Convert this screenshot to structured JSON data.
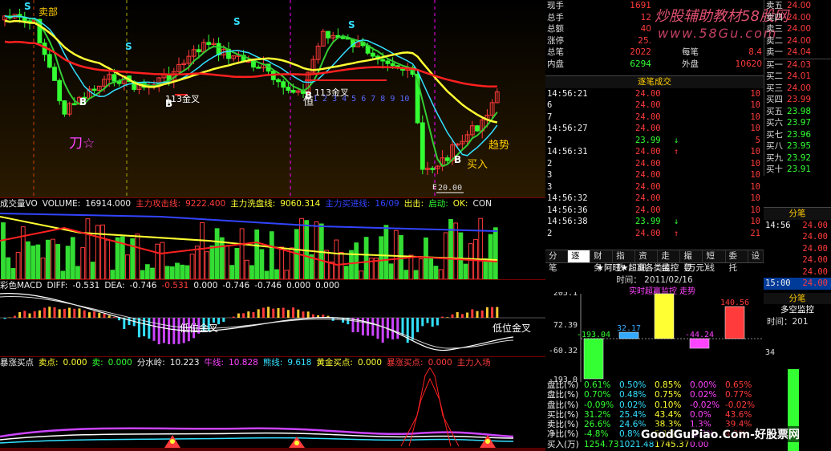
{
  "main": {
    "candle_labels": {
      "top_left": "卖部",
      "s_marks": [
        "S",
        "S",
        "S",
        "S"
      ],
      "b_marks": [
        "B",
        "B",
        "B",
        "B"
      ],
      "golden_cross_1": "113金叉",
      "golden_cross_2": "113金叉",
      "bottom_label": "刀☆",
      "trend": "趋势",
      "buy": "买入",
      "low_price": "20.00",
      "marker_e": "E",
      "marker_ha": "恒",
      "seq": "1 2 3 4 5 6 7 8 9 10"
    },
    "volume": {
      "title": "成交量VO",
      "volume_label": "VOLUME:",
      "volume_value": "16914.000",
      "main_attack": "主力攻击线:",
      "main_attack_val": "9222.400",
      "main_wash": "主力洗盘线:",
      "main_wash_val": "9060.314",
      "extra": "主力买进线:",
      "extra_val": "16/09",
      "shipping": "出击:",
      "start": "启动:",
      "ok": "OK:",
      "conf": "CON"
    },
    "macd": {
      "title": "彩色MACD",
      "diff_label": "DIFF:",
      "diff_val": "-0.531",
      "dea_label": "DEA:",
      "dea_val": "-0.746",
      "v3": "-0.531",
      "v4": "0.000",
      "v5": "-0.746",
      "v6": "-0.746",
      "v7": "0.000",
      "v8": "0.000",
      "cross1": "低位金叉",
      "cross2": "低位金叉"
    },
    "limit": {
      "title": "暴涨买点",
      "buy_label": "卖点:",
      "buy_val": "0.000",
      "sell_label": "卖:",
      "sell_val": "0.000",
      "divide_label": "分水岭:",
      "divide_val": "10.223",
      "bull_label": "牛线:",
      "bull_val": "10.828",
      "bear_label": "熊线:",
      "bear_val": "9.618",
      "gold_label": "黄金买点:",
      "gold_val": "0.000",
      "surge_label": "暴涨买点:",
      "surge_val": "0.000",
      "main_in": "主力入场"
    }
  },
  "quote": {
    "rows": [
      {
        "label": "现手",
        "value": "1691",
        "label2": "",
        "value2": ""
      },
      {
        "label": "总手",
        "value": "12",
        "label2": "",
        "value2": ""
      },
      {
        "label": "总额",
        "value": "40",
        "label2": "",
        "value2": ""
      },
      {
        "label": "涨停",
        "value": "25.",
        "label2": "",
        "value2": ""
      },
      {
        "label": "总笔",
        "value": "2022",
        "label2": "每笔",
        "value2": "8.4"
      },
      {
        "label": "内盘",
        "value": "6294",
        "label2": "外盘",
        "value2": "10620"
      }
    ],
    "watermark_1": "炒股辅助教材58股网",
    "watermark_2": "www.58Gu.com"
  },
  "ladder": [
    {
      "label": "卖五",
      "price": "24.00"
    },
    {
      "label": "卖四",
      "price": "24.00"
    },
    {
      "label": "卖三",
      "price": "24.00"
    },
    {
      "label": "卖二",
      "price": "24.00"
    },
    {
      "label": "卖一",
      "price": "24.04"
    },
    {
      "label": "买一",
      "price": "24.03"
    },
    {
      "label": "买二",
      "price": "24.01"
    },
    {
      "label": "买三",
      "price": "24.00"
    },
    {
      "label": "买四",
      "price": "23.99"
    },
    {
      "label": "买五",
      "price": "23.98"
    },
    {
      "label": "买六",
      "price": "23.97"
    },
    {
      "label": "买七",
      "price": "23.96"
    },
    {
      "label": "买八",
      "price": "23.95"
    },
    {
      "label": "买九",
      "price": "23.92"
    },
    {
      "label": "买十",
      "price": "23.91"
    }
  ],
  "ticks": {
    "title": "逐笔成交",
    "rows": [
      {
        "time": "14:56:21",
        "price": "24.00",
        "vol": "10",
        "arrow": ""
      },
      {
        "time": "6",
        "price": "24.00",
        "vol": "10",
        "arrow": ""
      },
      {
        "time": "7",
        "price": "24.00",
        "vol": "10",
        "arrow": ""
      },
      {
        "time": "14:56:27",
        "price": "24.00",
        "vol": "10",
        "arrow": ""
      },
      {
        "time": "2",
        "price": "23.99",
        "vol": "5",
        "arrow": "down"
      },
      {
        "time": "14:56:31",
        "price": "24.00",
        "vol": "10",
        "arrow": "up"
      },
      {
        "time": "2",
        "price": "24.00",
        "vol": "10",
        "arrow": ""
      },
      {
        "time": "3",
        "price": "24.00",
        "vol": "10",
        "arrow": ""
      },
      {
        "time": "3",
        "price": "24.00",
        "vol": "10",
        "arrow": ""
      },
      {
        "time": "14:56:32",
        "price": "24.00",
        "vol": "10",
        "arrow": ""
      },
      {
        "time": "14:56:36",
        "price": "24.00",
        "vol": "10",
        "arrow": ""
      },
      {
        "time": "14:56:38",
        "price": "23.99",
        "vol": "10",
        "arrow": "down"
      },
      {
        "time": "2",
        "price": "24.00",
        "vol": "21",
        "arrow": "up"
      }
    ]
  },
  "tabs": [
    "分笔",
    "逐笔",
    "财务",
    "指数",
    "资讯",
    "走线",
    "撮要",
    "短线",
    "委托",
    "设"
  ],
  "far_right": {
    "title": "分笔",
    "rows": [
      {
        "time": "14:56",
        "price": "24.00"
      },
      {
        "time": "",
        "price": "24.00"
      },
      {
        "time": "",
        "price": "24.00"
      },
      {
        "time": "",
        "price": "24.00"
      },
      {
        "time": "",
        "price": "24.00"
      },
      {
        "time": "15:00",
        "price": "24.00"
      }
    ],
    "sub_title": "分笔",
    "sub_title2": "多空监控",
    "date": "时间：201"
  },
  "flow": {
    "title": "★阿旺★超赢各类监控（万元）",
    "date": "时间： 2011/02/16",
    "subtitle": "实时超赢监控   走势",
    "y_labels": [
      "205.1",
      "72.39",
      "-60.32",
      "-193.0"
    ],
    "bar_labels": [
      "-193.04",
      "32.17",
      "",
      "-44.24",
      "140.56"
    ],
    "stats": [
      {
        "label": "盘比(%)",
        "v": [
          "0.61%",
          "0.50%",
          "0.85%",
          "0.00%",
          "0.65%"
        ]
      },
      {
        "label": "盘比(%)",
        "v": [
          "0.70%",
          "0.48%",
          "0.75%",
          "0.02%",
          "0.77%"
        ]
      },
      {
        "label": "盘比(%)",
        "v": [
          "-0.09%",
          "0.02%",
          "0.10%",
          "-0.02%",
          "-0.02%"
        ]
      },
      {
        "label": "买比(%)",
        "v": [
          "31.2%",
          "25.4%",
          "43.4%",
          "0.0%",
          "43.6%"
        ]
      },
      {
        "label": "卖比(%)",
        "v": [
          "26.6%",
          "24.6%",
          "38.3%",
          "1.3%",
          "39.4%"
        ]
      },
      {
        "label": "净比(%)",
        "v": [
          "-4.8%",
          "0.8%",
          "5.1%",
          "-1.3%",
          "4.2%"
        ]
      },
      {
        "label": "买入(万)",
        "v": [
          "1254.73",
          "1021.48",
          "1745.37",
          "0.00",
          ""
        ]
      }
    ]
  },
  "footer_watermark": "GoodGuPiao.Com-好股票网",
  "colors": {
    "up": "#ff3b3b",
    "down": "#33ff33",
    "ma_yellow": "#ffff33",
    "ma_cyan": "#33e0ff",
    "ma_red": "#ff2020",
    "ma_blue": "#3344ff"
  }
}
